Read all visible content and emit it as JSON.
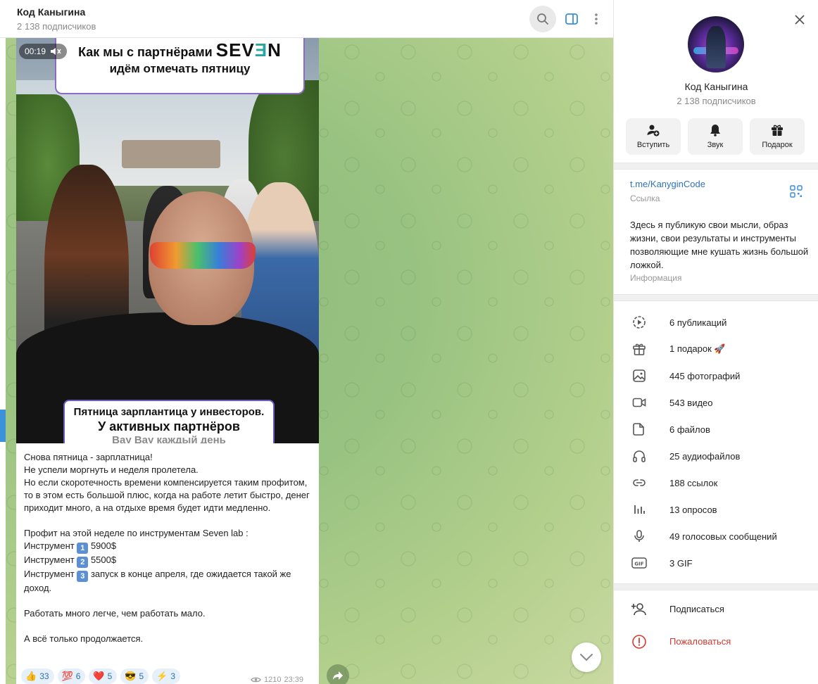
{
  "chat": {
    "title": "Код Каныгина",
    "subscribers": "2 138 подписчиков"
  },
  "video": {
    "time": "00:19",
    "caption_top_line1": "Как мы с партнёрами",
    "caption_brand_a": "SEV",
    "caption_brand_b": "Ǝ",
    "caption_brand_c": "N",
    "caption_top_line2": "идём отмечать пятницу",
    "caption_bottom_line1": "Пятница зарплантица у инвесторов.",
    "caption_bottom_line2": "У активных партнёров",
    "caption_bottom_line3": "Вау Вау каждый день"
  },
  "message": {
    "text_part1": "Снова пятница - зарплатница!\nНе успели моргнуть и неделя пролетела.\nНо если скоротечность времени компенсируется таким профитом, то в этом есть большой плюс, когда на работе летит быстро, денег приходит много, а на отдыхе время будет идти медленно.\n\nПрофит на этой неделе по инструментам Seven lab :\n",
    "instruments": [
      {
        "label": "Инструмент ",
        "num": "1",
        "rest": " 5900$"
      },
      {
        "label": "Инструмент ",
        "num": "2",
        "rest": " 5500$"
      },
      {
        "label": "Инструмент ",
        "num": "3",
        "rest": " запуск в конце апреля, где ожидается такой же доход."
      }
    ],
    "text_part2": "\nРаботать много легче, чем работать мало.\n\nА всё только продолжается.",
    "reactions": [
      {
        "emoji": "👍",
        "count": "33"
      },
      {
        "emoji": "💯",
        "count": "6"
      },
      {
        "emoji": "❤️",
        "count": "5"
      },
      {
        "emoji": "😎",
        "count": "5"
      },
      {
        "emoji": "⚡",
        "count": "3"
      }
    ],
    "views": "1210",
    "time": "23:39"
  },
  "panel": {
    "name": "Код Каныгина",
    "subscribers": "2 138 подписчиков",
    "actions": [
      {
        "label": "Вступить",
        "icon": "add-user-icon"
      },
      {
        "label": "Звук",
        "icon": "bell-icon"
      },
      {
        "label": "Подарок",
        "icon": "gift-icon"
      }
    ],
    "link": "t.me/KanyginCode",
    "link_caption": "Ссылка",
    "about": "Здесь я публикую свои мысли, образ жизни, свои результаты и инструменты позволяющие мне кушать жизнь большой ложкой.",
    "about_caption": "Информация",
    "stats": [
      {
        "icon": "stories-icon",
        "text": "6 публикаций"
      },
      {
        "icon": "gift-icon",
        "text": "1 подарок 🚀"
      },
      {
        "icon": "photo-icon",
        "text": "445 фотографий"
      },
      {
        "icon": "video-icon",
        "text": "543 видео"
      },
      {
        "icon": "file-icon",
        "text": "6 файлов"
      },
      {
        "icon": "headphones-icon",
        "text": "25 аудиофайлов"
      },
      {
        "icon": "link-icon",
        "text": "188 ссылок"
      },
      {
        "icon": "poll-icon",
        "text": "13 опросов"
      },
      {
        "icon": "microphone-icon",
        "text": "49 голосовых сообщений"
      },
      {
        "icon": "gif-icon",
        "text": "3 GIF"
      }
    ],
    "subscribe": "Подписаться",
    "report": "Пожаловаться"
  },
  "colors": {
    "accent": "#2e72b8",
    "danger": "#d4392f",
    "reaction_bg": "#e6f0fa"
  }
}
